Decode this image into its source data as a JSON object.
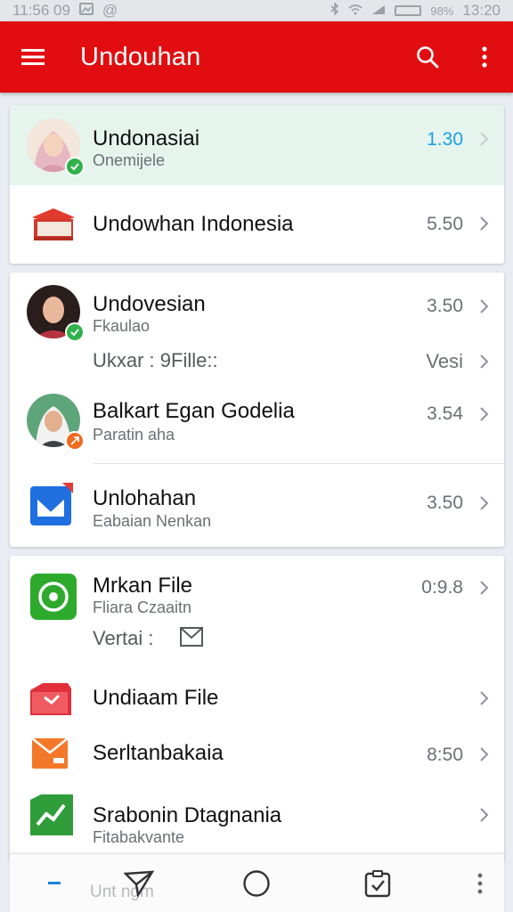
{
  "status": {
    "left_time": "11:56 09",
    "right_time": "13:20",
    "battery": "98%"
  },
  "appbar": {
    "title": "Undouhan"
  },
  "items": [
    {
      "main": "Undonasiai",
      "sub": "Onemijele",
      "value": "1.30"
    },
    {
      "main": "Undowhan Indonesia",
      "value": "5.50"
    },
    {
      "main": "Undovesian",
      "sub": "Fkaulao",
      "value": "3.50"
    },
    {
      "main": "Ukxar : 9Fille::",
      "value": "Vesi"
    },
    {
      "main": "Balkart Egan Godelia",
      "sub": "Paratin aha",
      "value": "3.54"
    },
    {
      "main": "Unlohahan",
      "sub": "Eabaian Nenkan",
      "value": "3.50"
    },
    {
      "main": "Mrkan File",
      "sub": "Fliara Czaaitn",
      "value": "0:9.8"
    },
    {
      "main": "Vertai :"
    },
    {
      "main": "Undiaam File"
    },
    {
      "main": "Serltanbakaia",
      "value": "8:50"
    },
    {
      "main": "Srabonin Dtagnania",
      "sub": "Fitabakvante"
    }
  ],
  "navbar": {
    "label": "Unt ngm"
  },
  "colors": {
    "accent": "#e20d10",
    "highlight_row": "#e6f4ee",
    "value_blue": "#1aa1e6"
  }
}
